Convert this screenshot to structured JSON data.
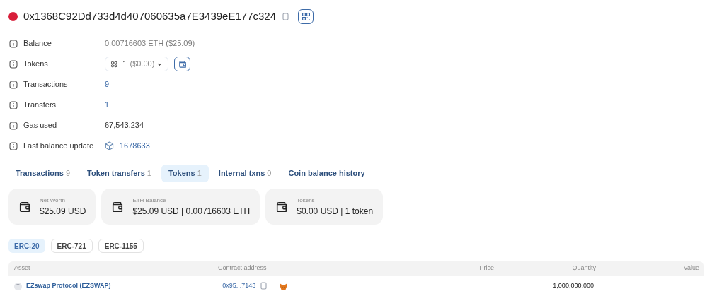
{
  "address": {
    "text": "0x1368C92Dd733d4d407060635a7E3439eE177c324"
  },
  "details": [
    {
      "label": "Balance",
      "kind": "text",
      "value": "0.00716603 ETH ($25.09)"
    },
    {
      "label": "Tokens",
      "kind": "tokens",
      "count": "1",
      "amount": "($0.00)"
    },
    {
      "label": "Transactions",
      "kind": "link",
      "value": "9"
    },
    {
      "label": "Transfers",
      "kind": "link",
      "value": "1"
    },
    {
      "label": "Gas used",
      "kind": "plain",
      "value": "67,543,234"
    },
    {
      "label": "Last balance update",
      "kind": "block",
      "value": "1678633"
    }
  ],
  "tabs": [
    {
      "label": "Transactions",
      "count": "9",
      "selected": false
    },
    {
      "label": "Token transfers",
      "count": "1",
      "selected": false
    },
    {
      "label": "Tokens",
      "count": "1",
      "selected": true
    },
    {
      "label": "Internal txns",
      "count": "0",
      "selected": false
    },
    {
      "label": "Coin balance history",
      "selected": false
    }
  ],
  "cards": [
    {
      "label": "Net Worth",
      "value": "$25.09 USD"
    },
    {
      "label": "ETH Balance",
      "value": "$25.09 USD | 0.00716603 ETH"
    },
    {
      "label": "Tokens",
      "value": "$0.00 USD | 1 token"
    }
  ],
  "filters": [
    {
      "label": "ERC-20",
      "selected": true
    },
    {
      "label": "ERC-721",
      "selected": false
    },
    {
      "label": "ERC-1155",
      "selected": false
    }
  ],
  "table": {
    "columns": [
      "Asset",
      "Contract address",
      "Price",
      "Quantity",
      "Value"
    ],
    "rows": [
      {
        "badge": "T",
        "asset": "EZswap Protocol (EZSWAP)",
        "contract": "0x95...7143",
        "quantity": "1,000,000,000"
      }
    ]
  }
}
